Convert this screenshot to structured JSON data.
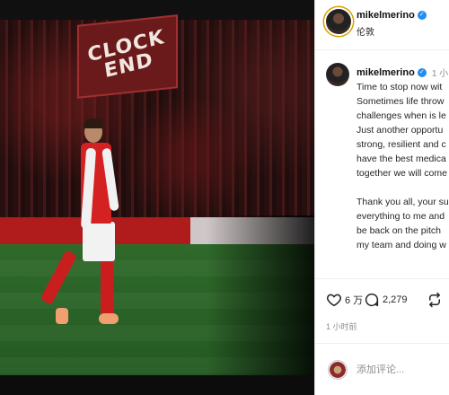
{
  "photo": {
    "banner_text": "CLOCK END"
  },
  "post": {
    "username": "mikelmerino",
    "verified_mark": "✓",
    "location": "伦敦",
    "caption": {
      "username": "mikelmerino",
      "time": "1 小",
      "lines": [
        "Time to stop now wit",
        "Sometimes life throw",
        "challenges when is le",
        "Just another opportu",
        "strong, resilient and c",
        "have the best medica",
        "together we will come",
        "",
        "Thank you all, your su",
        "everything to me and",
        "be back on the pitch",
        "my team and doing w"
      ]
    },
    "actions": {
      "likes": "6 万",
      "comments": "2,279",
      "like_icon": "heart-icon",
      "comment_icon": "comment-bubble-icon",
      "share_icon": "repost-icon"
    },
    "time_ago": "1 小时前",
    "comment_placeholder": "添加评论..."
  }
}
